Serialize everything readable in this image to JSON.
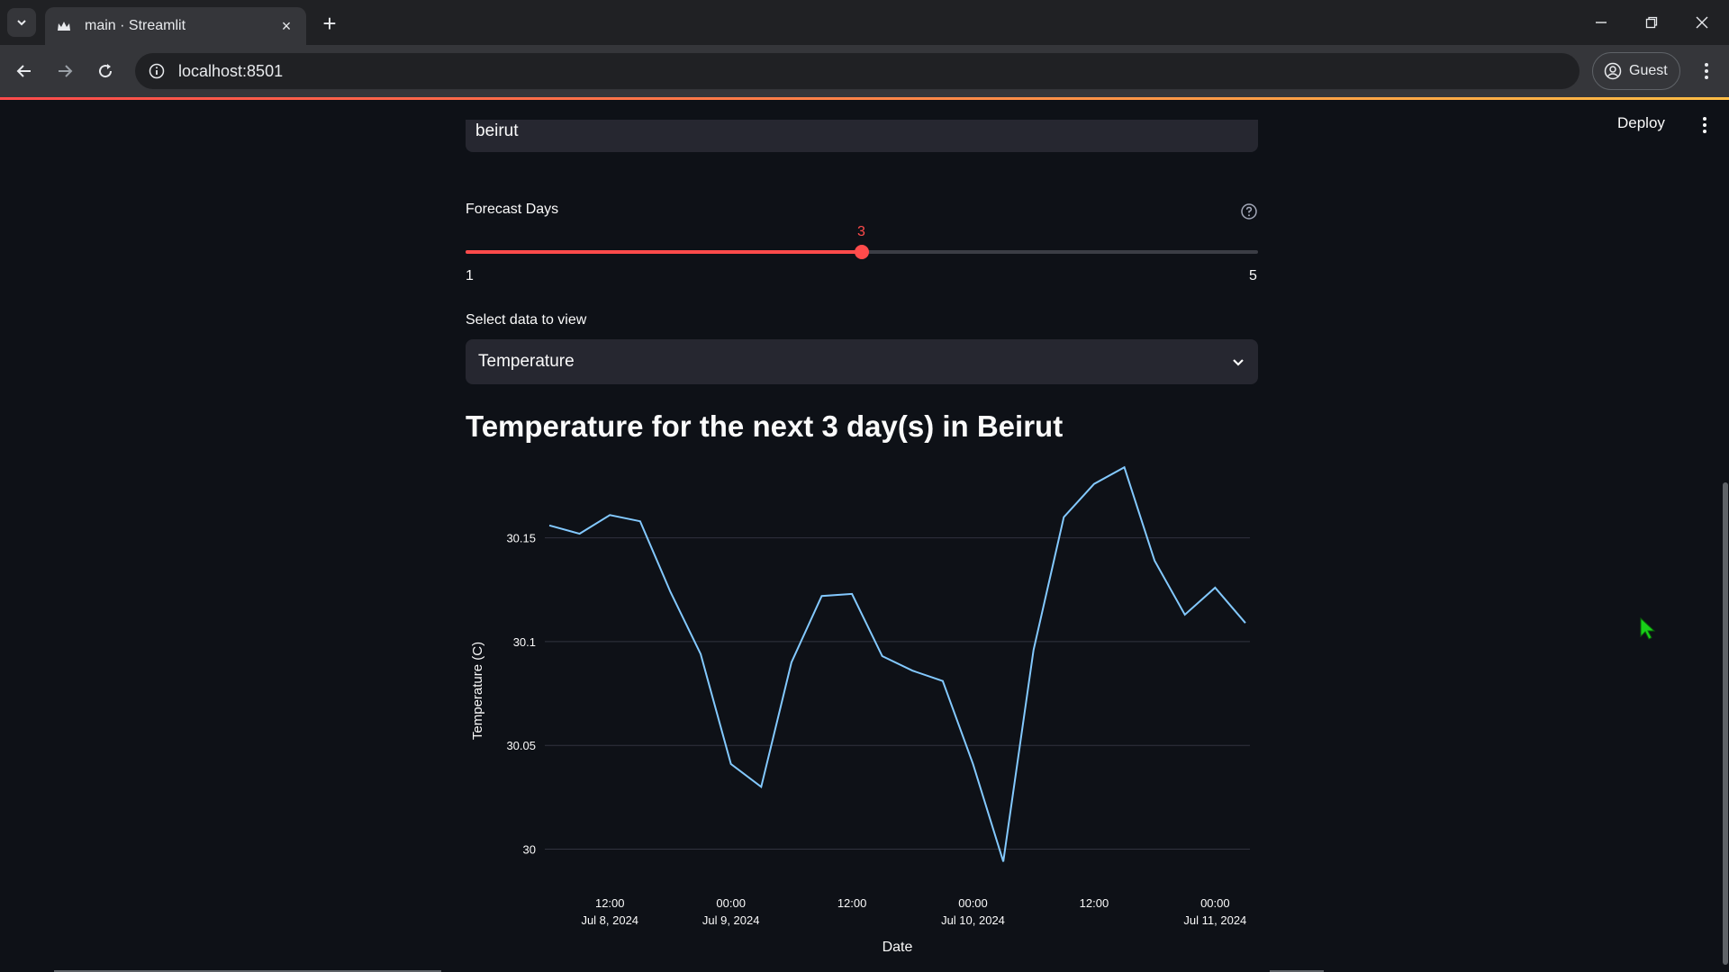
{
  "browser": {
    "tab_title": "main · Streamlit",
    "url": "localhost:8501",
    "profile_label": "Guest"
  },
  "app": {
    "deploy_label": "Deploy",
    "city_input_value": "beirut",
    "forecast_label": "Forecast Days",
    "slider": {
      "value": 3,
      "value_label": "3",
      "min_label": "1",
      "max_label": "5",
      "min": 1,
      "max": 5
    },
    "select_label": "Select data to view",
    "select_value": "Temperature",
    "heading": "Temperature for the next 3 day(s) in Beirut",
    "accent_color": "#ff4b4b"
  },
  "chart_data": {
    "type": "line",
    "xlabel": "Date",
    "ylabel": "Temperature (C)",
    "ylim": [
      29.995,
      30.175
    ],
    "yticks": [
      {
        "value": 30,
        "label": "30"
      },
      {
        "value": 30.05,
        "label": "30.05"
      },
      {
        "value": 30.1,
        "label": "30.1"
      },
      {
        "value": 30.15,
        "label": "30.15"
      }
    ],
    "xticks": [
      {
        "index": 2,
        "label1": "12:00",
        "label2": "Jul 8, 2024"
      },
      {
        "index": 6,
        "label1": "00:00",
        "label2": "Jul 9, 2024"
      },
      {
        "index": 10,
        "label1": "12:00",
        "label2": ""
      },
      {
        "index": 14,
        "label1": "00:00",
        "label2": "Jul 10, 2024"
      },
      {
        "index": 18,
        "label1": "12:00",
        "label2": ""
      },
      {
        "index": 22,
        "label1": "00:00",
        "label2": "Jul 11, 2024"
      }
    ],
    "x": [
      "2024-07-08 06:00",
      "2024-07-08 09:00",
      "2024-07-08 12:00",
      "2024-07-08 15:00",
      "2024-07-08 18:00",
      "2024-07-08 21:00",
      "2024-07-09 00:00",
      "2024-07-09 03:00",
      "2024-07-09 06:00",
      "2024-07-09 09:00",
      "2024-07-09 12:00",
      "2024-07-09 15:00",
      "2024-07-09 18:00",
      "2024-07-09 21:00",
      "2024-07-10 00:00",
      "2024-07-10 03:00",
      "2024-07-10 06:00",
      "2024-07-10 09:00",
      "2024-07-10 12:00",
      "2024-07-10 15:00",
      "2024-07-10 18:00",
      "2024-07-10 21:00",
      "2024-07-11 00:00",
      "2024-07-11 03:00"
    ],
    "series": [
      {
        "values": [
          30.156,
          30.152,
          30.161,
          30.158,
          30.124,
          30.094,
          30.041,
          30.03,
          30.09,
          30.122,
          30.123,
          30.093,
          30.086,
          30.081,
          30.041,
          29.994,
          30.096,
          30.16,
          30.176,
          30.184,
          30.139,
          30.113,
          30.126,
          30.109
        ],
        "color": "#83c9ff"
      }
    ],
    "grid": true
  }
}
